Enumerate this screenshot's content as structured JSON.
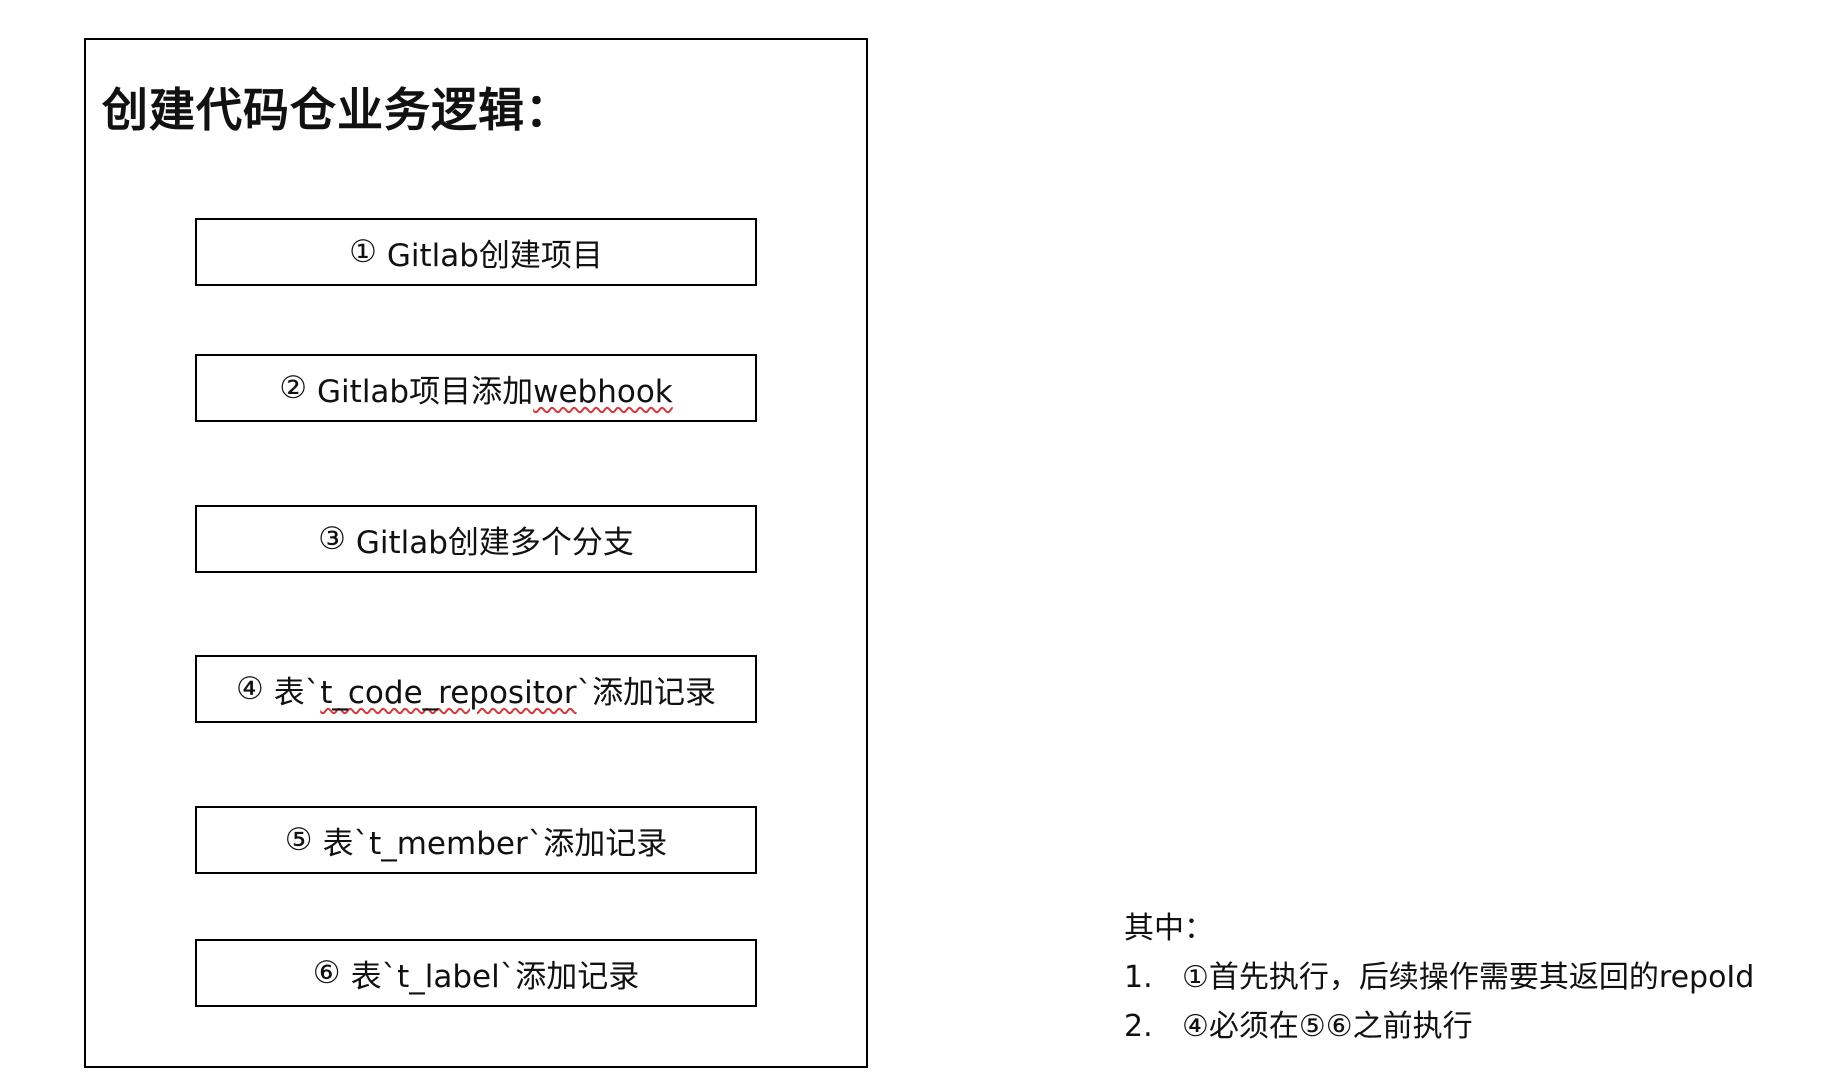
{
  "title": "创建代码仓业务逻辑：",
  "steps": [
    {
      "marker": "①",
      "text": "Gitlab创建项目"
    },
    {
      "marker": "②",
      "text_before": "Gitlab项目添加",
      "text_flag": "webhook",
      "text_after": ""
    },
    {
      "marker": "③",
      "text": "Gitlab创建多个分支"
    },
    {
      "marker": "④",
      "text_before": "表`",
      "text_flag": "t_code_repositor",
      "text_after": "`添加记录"
    },
    {
      "marker": "⑤",
      "text": "表`t_member`添加记录"
    },
    {
      "marker": "⑥",
      "text": "表`t_label`添加记录"
    }
  ],
  "notes": {
    "heading": "其中：",
    "items": [
      {
        "num": "1.",
        "text": "①首先执行，后续操作需要其返回的repoId"
      },
      {
        "num": "2.",
        "text": "④必须在⑤⑥之前执行"
      }
    ]
  },
  "colors": {
    "border": "#000000",
    "text": "#111111",
    "spellcheck_underline": "#d33b3b",
    "background": "#ffffff"
  }
}
